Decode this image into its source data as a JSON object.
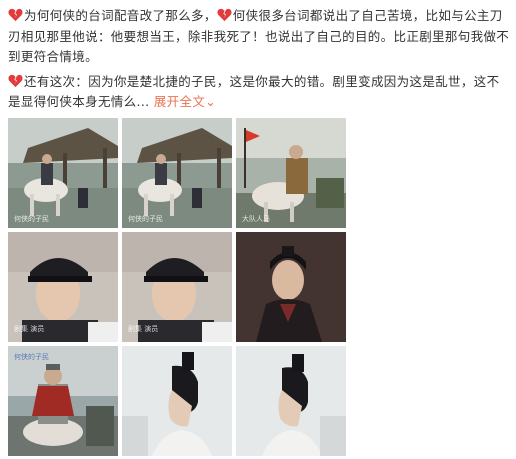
{
  "post": {
    "line1_after_heart": "为何何侠的台词配音改了那么多，",
    "line1_after_heart2": "何侠很多台词都说出了自己苦境，比如与公主刀刃相见那里他说：他要想当王，除非我死了！也说出了自己的目的。比正剧里那句我做不到更符合情境。",
    "line2_after_heart": "还有这次：因为你是楚北捷的子民，这是你最大的错。剧里变成因为这是乱世，这不是显得何侠本身无情么",
    "ellipsis": "...",
    "expand_label": "展开全文",
    "expand_arrow": "⌄"
  },
  "icons": {
    "heart": "broken-heart-icon"
  },
  "colors": {
    "text": "#333333",
    "link": "#eb7350",
    "heart": "#e23b3b"
  },
  "images": [
    {
      "name": "photo-1",
      "caption": "何侠的子民"
    },
    {
      "name": "photo-2",
      "caption": "何侠的子民"
    },
    {
      "name": "photo-3",
      "caption": "大队人马"
    },
    {
      "name": "photo-4",
      "caption": "剧集 演员"
    },
    {
      "name": "photo-5",
      "caption": "剧集 演员"
    },
    {
      "name": "photo-6",
      "caption": ""
    },
    {
      "name": "photo-7",
      "caption": "何侠的子民"
    },
    {
      "name": "photo-8",
      "caption": ""
    },
    {
      "name": "photo-9",
      "caption": ""
    }
  ]
}
